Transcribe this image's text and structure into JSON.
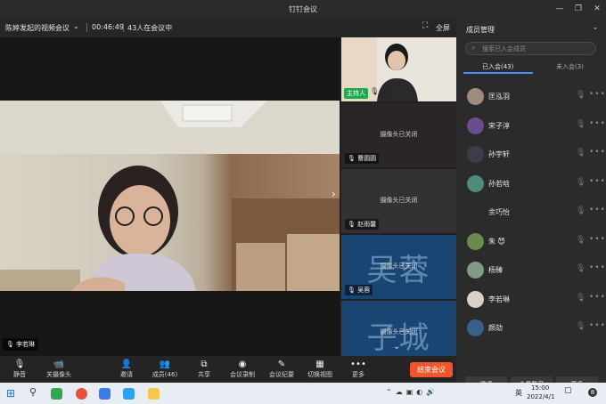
{
  "window": {
    "title": "钉钉会议"
  },
  "infobar": {
    "meeting_name": "陈婷发起的视频会议",
    "duration": "00:46:49",
    "attendee_status": "43人在会议中",
    "fullscreen": "全屏"
  },
  "main_video": {
    "speaker_name": "李若琳"
  },
  "strip": {
    "host_badge": "主持人",
    "self_name": "我",
    "camera_off": "摄像头已关闭",
    "tiles": [
      {
        "name": "曹圆圆"
      },
      {
        "name": "赵雨馨"
      },
      {
        "name": "吴蓉",
        "avatar_text": "吴蓉"
      },
      {
        "avatar_text": "子城"
      }
    ]
  },
  "toolbar": {
    "mute": "静音",
    "camera": "关摄像头",
    "invite": "邀请",
    "members": "成员(46)",
    "share": "共享",
    "record": "会议录制",
    "minutes": "会议纪要",
    "switch_view": "切换视图",
    "more": "更多",
    "end": "结束会议"
  },
  "panel": {
    "title": "成员管理",
    "search_placeholder": "搜索已入会成员",
    "tab_joined": "已入会(43)",
    "tab_not_joined": "未入会(3)",
    "members": [
      {
        "name": "匡泓羽",
        "avatar_color": "#a08a7a"
      },
      {
        "name": "宋子淳",
        "avatar_color": "#6a4d8a"
      },
      {
        "name": "孙宇轩",
        "avatar_color": "#3d3d4a"
      },
      {
        "name": "孙若晗",
        "avatar_color": "#4f8b7c"
      },
      {
        "name": "余巧怡",
        "avatar_color": "#2a2a2a"
      },
      {
        "name": "朱 😈",
        "avatar_color": "#6c8a4d"
      },
      {
        "name": "杨臻",
        "avatar_color": "#7f9a8a"
      },
      {
        "name": "李若琳",
        "avatar_color": "#d8d2c8"
      },
      {
        "name": "颜劼",
        "avatar_color": "#3a5f8a"
      }
    ],
    "btn_invite": "邀请",
    "btn_mute_all": "全员静音",
    "btn_more": "更多"
  },
  "taskbar": {
    "time": "15:00",
    "date": "2022/4/1",
    "ime": "英",
    "notification_count": "8"
  },
  "colors": {
    "accent": "#4a8cff",
    "end_button": "#f2552c",
    "host_badge": "#1faa4b"
  }
}
